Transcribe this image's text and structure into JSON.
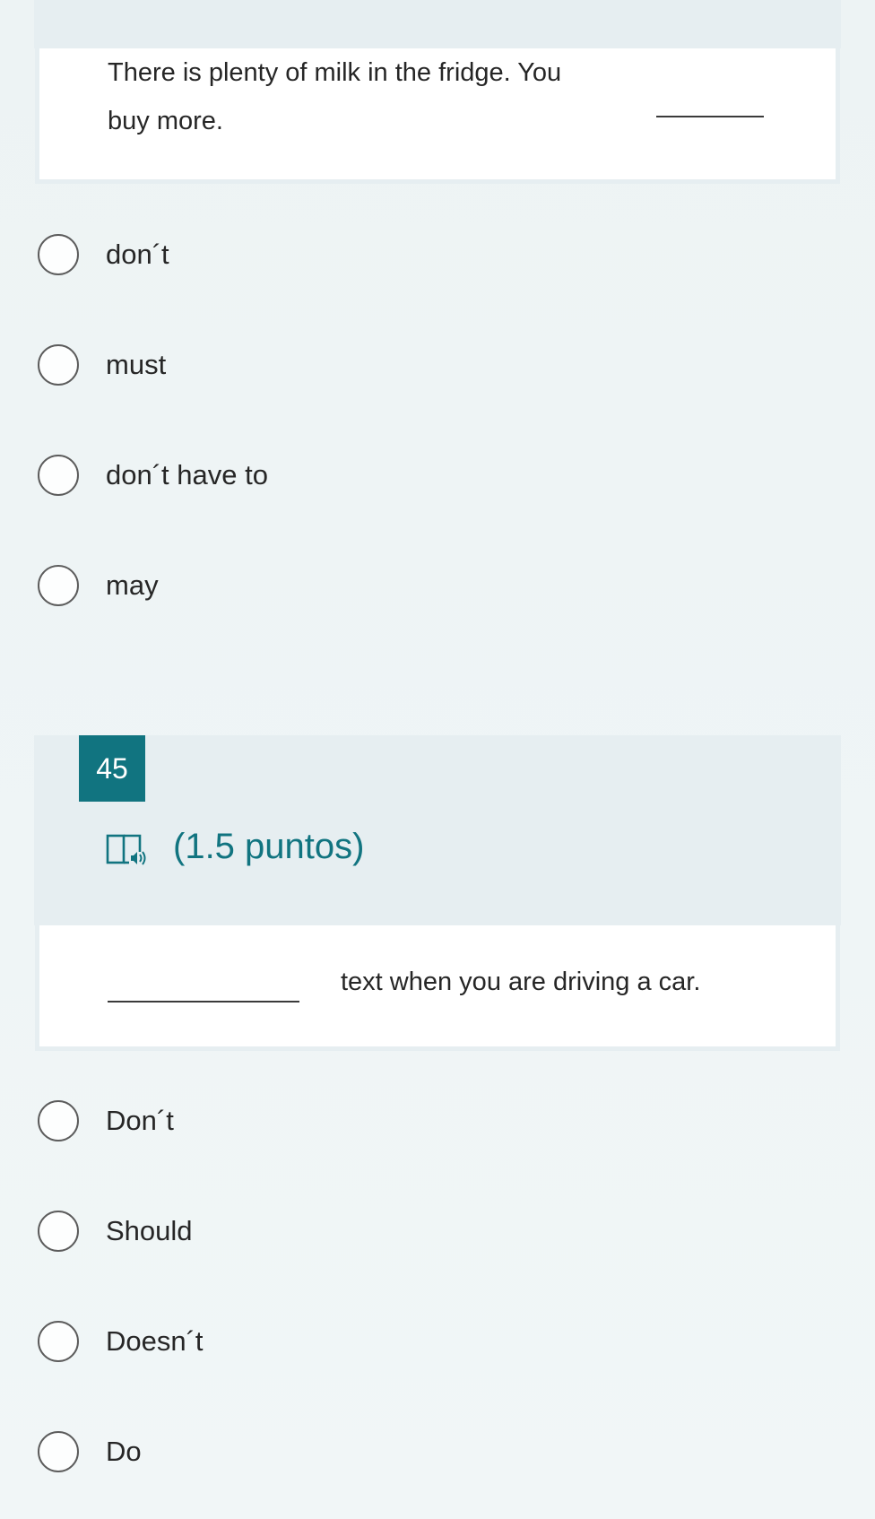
{
  "question_44": {
    "text_line1": "There is plenty of milk in the fridge. You",
    "text_line2": "buy more.",
    "options": [
      "don´t",
      "must",
      "don´t have to",
      "may"
    ]
  },
  "question_45": {
    "number": "45",
    "points": "(1.5 puntos)",
    "text": "text when you are driving a car.",
    "options": [
      "Don´t",
      "Should",
      "Doesn´t",
      "Do"
    ]
  },
  "icons": {
    "reader": "immersive-reader-icon",
    "option": "radio-button-icon"
  },
  "colors": {
    "accent": "#117480",
    "card": "#ffffff",
    "header_band": "#e6eef1",
    "page": "#eef4f5"
  }
}
